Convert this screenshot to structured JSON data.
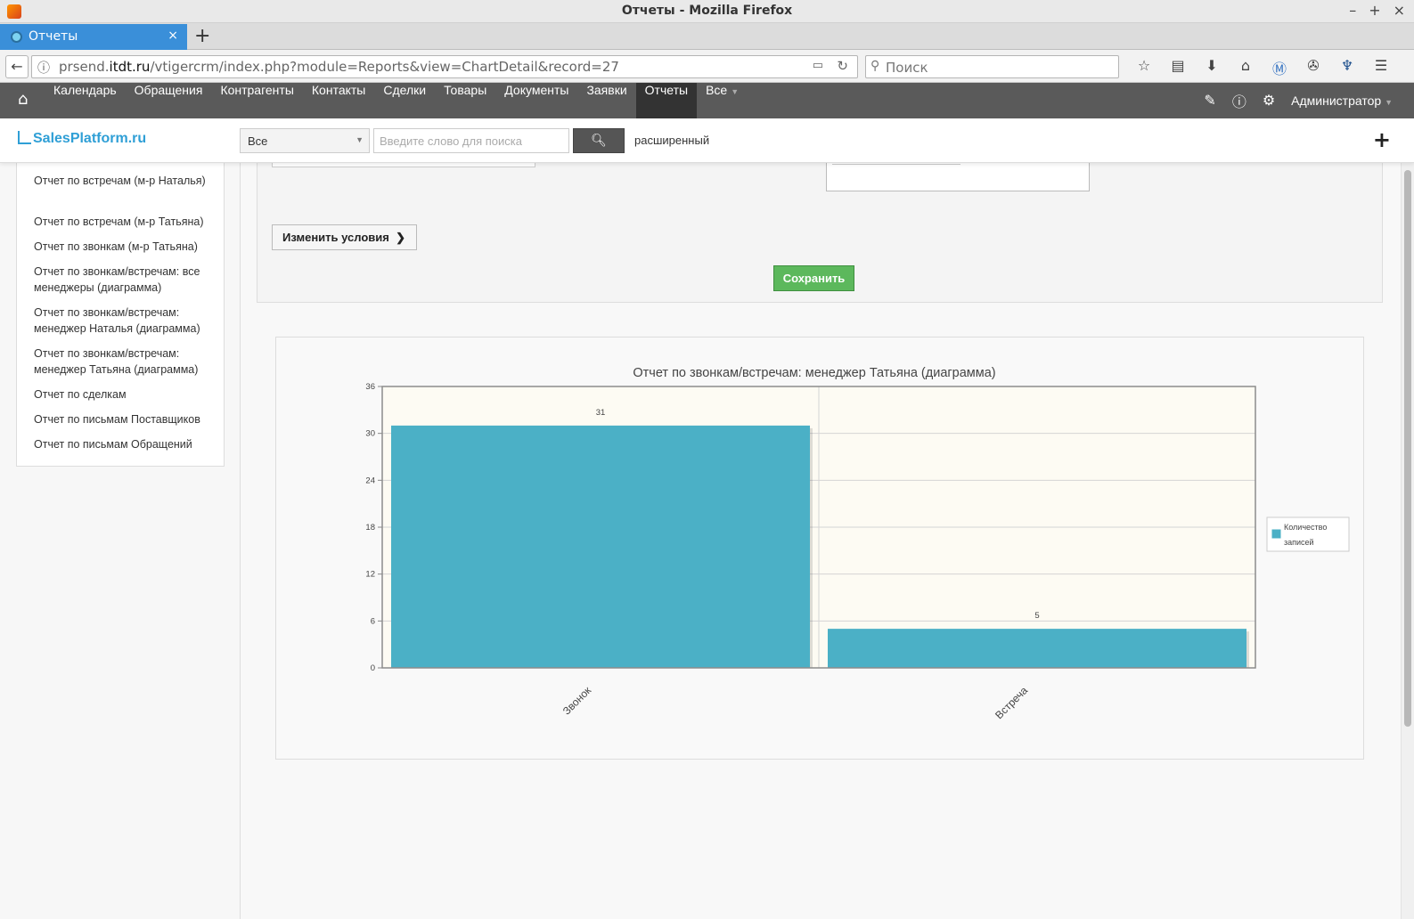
{
  "window": {
    "title": "Отчеты - Mozilla Firefox"
  },
  "tab": {
    "label": "Отчеты"
  },
  "address": {
    "host_prefix": "prsend.",
    "host_main": "itdt.ru",
    "path": "/vtigercrm/index.php?module=Reports&view=ChartDetail&record=27"
  },
  "browser_search": {
    "placeholder": "Поиск"
  },
  "browser_toolbar_icons": [
    "star-icon",
    "clipboard-icon",
    "download-icon",
    "home-icon",
    "extension-m-icon",
    "puzzle-icon",
    "figure-icon",
    "menu-icon"
  ],
  "crm_menu": {
    "items": [
      "Календарь",
      "Обращения",
      "Контрагенты",
      "Контакты",
      "Сделки",
      "Товары",
      "Документы",
      "Заявки",
      "Отчеты",
      "Все"
    ],
    "active": "Отчеты",
    "user": "Администратор"
  },
  "header": {
    "logo": "SalesPlatform.ru",
    "search_scope": "Все",
    "search_placeholder": "Введите слово для поиска",
    "advanced": "расширенный"
  },
  "sidebar": {
    "items": [
      "Отчет по встречам (м-р Наталья)",
      "Отчет по встречам (м-р Татьяна)",
      "Отчет по звонкам (м-р Татьяна)",
      "Отчет по звонкам/встречам: все менеджеры (диаграмма)",
      "Отчет по звонкам/встречам: менеджер Наталья (диаграмма)",
      "Отчет по звонкам/встречам: менеджер Татьяна (диаграмма)",
      "Отчет по сделкам",
      "Отчет по письмам Поставщиков",
      "Отчет по письмам Обращений"
    ]
  },
  "actions": {
    "edit_conditions": "Изменить условия",
    "save": "Сохранить"
  },
  "chart_data": {
    "type": "bar",
    "title": "Отчет по звонкам/встречам: менеджер Татьяна (диаграмма)",
    "categories": [
      "Звонок",
      "Встреча"
    ],
    "series": [
      {
        "name": "Количество записей",
        "values": [
          31,
          5
        ]
      }
    ],
    "data_labels": [
      "31",
      "5"
    ],
    "ylim": [
      0,
      36
    ],
    "yticks": [
      "0",
      "6",
      "12",
      "18",
      "24",
      "30",
      "36"
    ],
    "grid": true,
    "legend": "right",
    "colors": {
      "bar": "#4bb0c6",
      "plot_bg": "#fdfbf3"
    }
  }
}
